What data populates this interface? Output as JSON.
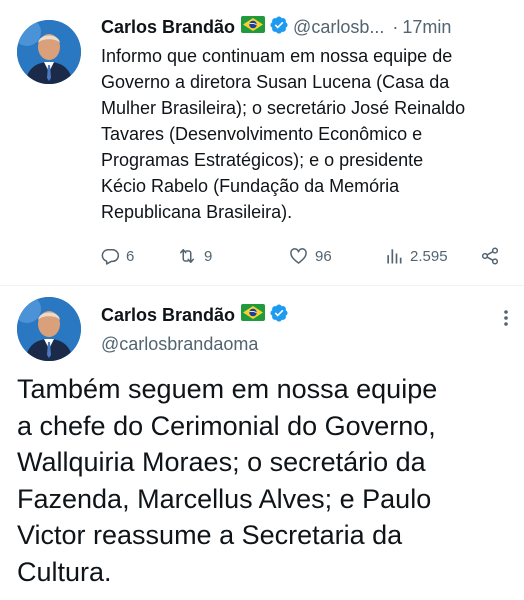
{
  "tweet1": {
    "author_name": "Carlos Brandão",
    "handle": "@carlosb...",
    "separator": "·",
    "time": "17min",
    "text_lines": [
      "Informo que continuam em nossa equipe de",
      "Governo a diretora Susan Lucena (Casa da",
      "Mulher Brasileira); o secretário José Reinaldo",
      "Tavares (Desenvolvimento Econômico e",
      "Programas Estratégicos); e o presidente",
      "Kécio Rabelo (Fundação da Memória",
      "Republicana Brasileira)."
    ],
    "actions": {
      "replies": "6",
      "retweets": "9",
      "likes": "96",
      "views": "2.595"
    }
  },
  "tweet2": {
    "author_name": "Carlos Brandão",
    "handle": "@carlosbrandaoma",
    "text_lines": [
      "Também seguem em nossa equipe",
      "a chefe do Cerimonial do Governo,",
      "Wallquiria Moraes; o secretário da",
      "Fazenda, Marcellus Alves; e Paulo",
      "Victor reassume a Secretaria da",
      "Cultura."
    ]
  },
  "icons": {
    "flag": "brazil-flag-icon",
    "verified": "verified-badge-icon",
    "reply": "reply-icon",
    "retweet": "retweet-icon",
    "like": "heart-icon",
    "views": "views-icon",
    "share": "share-icon",
    "more": "more-options-icon"
  },
  "colors": {
    "text": "#0f1419",
    "secondary": "#536471",
    "verified": "#1d9bf0",
    "divider": "#eff3f4"
  }
}
